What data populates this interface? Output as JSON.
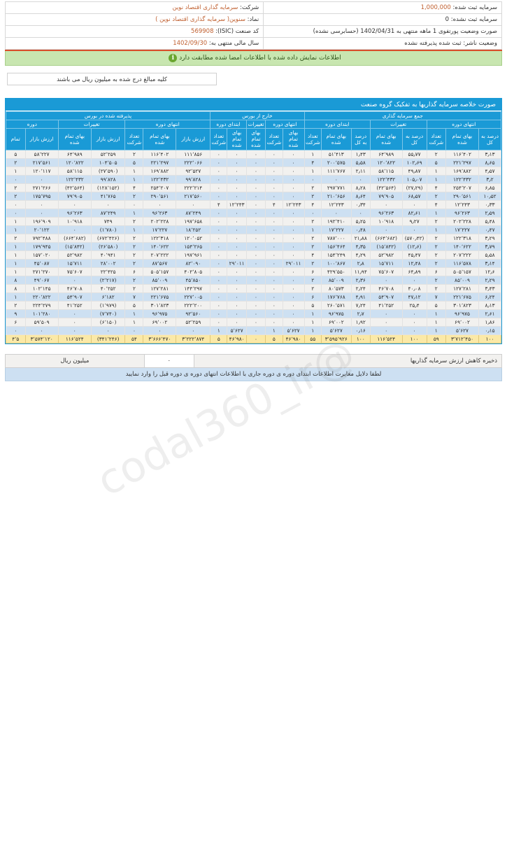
{
  "header": {
    "company_label": "شرکت:",
    "company_value": "سرمایه گذاری اقتصاد نوین",
    "registered_capital_label": "سرمایه ثبت شده:",
    "registered_capital_value": "1,000,000",
    "symbol_label": "نماد:",
    "symbol_value": "سنوین( سرمایه گذاری اقتصاد نوین )",
    "unregistered_capital_label": "سرمایه ثبت نشده:",
    "unregistered_capital_value": "0",
    "isic_label": "کد صنعت (ISIC):",
    "isic_value": "569908",
    "statement_label": "صورت وضعیت پورتفوی  1 ماهه منتهی به 1402/04/31 (حسابرسی نشده)",
    "fiscal_year_label": "سال مالی منتهی به:",
    "fiscal_year_value": "1402/09/30",
    "publisher_status_label": "وضعیت ناشر:",
    "publisher_status_value": "ثبت شده پذیرفته نشده",
    "notice": "اطلاعات نمایش داده شده با اطلاعات امضا شده مطابقت دارد",
    "notice_icon": "info-icon",
    "unit_note": "کلیه مبالغ درج شده به میلیون ریال می باشند"
  },
  "watermark": "@codal360_ir",
  "table": {
    "title": "صورت خلاصه سرمایه گذاریها به تفکیک گروه صنعت",
    "groups": [
      {
        "label": "پذیرفته شده در بورس",
        "span": 11
      },
      {
        "label": "خارج از بورس",
        "span": 8
      },
      {
        "label": "جمع سرمایه گذاری",
        "span": 8
      }
    ],
    "subgroups": [
      {
        "label": "دوره",
        "span": 3
      },
      {
        "label": "تغییرات",
        "span": 3
      },
      {
        "label": "انتهای دوره",
        "span": 3
      },
      {
        "label": "ابتدای دوره",
        "span": 3
      },
      {
        "label": "تغییرات",
        "span": 2
      },
      {
        "label": "انتهای دوره",
        "span": 2
      },
      {
        "label": "ابتدای دوره",
        "span": 3
      },
      {
        "label": "تغییرات",
        "span": 2
      },
      {
        "label": "انتهای دوره",
        "span": 3
      }
    ],
    "columns": [
      "درصد به کل",
      "بهای تمام شده",
      "تعداد شرکت",
      "درصد به کل",
      "بهای تمام شده",
      "درصد به کل",
      "بهای تمام شده",
      "تعداد شرکت",
      "بهای تمام شده",
      "تعداد شرکت",
      "بهای تمام شده",
      "بهای تمام شده",
      "تعداد شرکت",
      "ارزش بازار",
      "بهای تمام شده",
      "تعداد شرکت",
      "ارزش بازار",
      "بهای تمام شده",
      "ارزش بازار",
      "تمام"
    ],
    "rows": [
      {
        "zebra": "odd",
        "cells": [
          "٣٫١٣",
          "١١۶٬۴٠٢",
          "٢",
          "۵۵٫٧٧",
          "۶۴٬٩٨٩",
          "١٫۴٣",
          "۵١٬۴١٣",
          "١",
          "٠",
          "٠",
          "٠",
          "٠",
          "٠",
          "١١١٬٨۵۶",
          "١١۶٬۴٠٢",
          "٢",
          "۵٢٬٢۵٩",
          "۶۴٬٩٨٩",
          "۵٨٬٢٢٧",
          "۵"
        ]
      },
      {
        "zebra": "even",
        "cells": [
          "٨٫۶۵",
          "٢٢١٬٢٩٧",
          "۵",
          "١٠٢٫۶٩",
          "١٢٠٬٨٢٢",
          "۵٫۵٨",
          "٢٠٠٬۵٧۵",
          "۴",
          "٠",
          "٠",
          "٠",
          "٠",
          "٠",
          "٢٢٢٬٠۶۶",
          "٢٢١٬٢٩٧",
          "۵",
          "١٠۴٬۵٠۵",
          "١٢٠٬٨٢٢",
          "٢١٧٬۵۶١",
          "٢"
        ]
      },
      {
        "zebra": "odd",
        "cells": [
          "۴٫۵٧",
          "١۶٩٬٨٨٢",
          "١",
          "۴٩٫٨٧",
          "۵٨٬١١۵",
          "٢٫١١",
          "١١١٬٧۶٧",
          "١",
          "٠",
          "٠",
          "٠",
          "٠",
          "٠",
          "٩٢٬۵٢٧",
          "١۶٩٬٨٨٢",
          "١",
          "(٢٧٬۵٩٠)",
          "۵٨٬١١۵",
          "١٢٠٬١١٧",
          "١"
        ],
        "neg": [
          15
        ]
      },
      {
        "zebra": "even",
        "cells": [
          "٣٫٢",
          "١٢٢٬۴٣٢",
          "١",
          "١٠۵٫٠٧",
          "١٢٢٬۴٣٢",
          "٠",
          "٠",
          "٠",
          "٠",
          "٠",
          "٠",
          "٠",
          "٠",
          "٩٩٬٨٢٨",
          "١٢٢٬۴٣٢",
          "١",
          "٩٩٬٨٢٨",
          "١٢٢٬۴٣٢",
          "٠",
          "٠"
        ]
      },
      {
        "zebra": "odd",
        "cells": [
          "۶٫٨۵",
          "٢۵۴٬٢٠٧",
          "۴",
          "(٢٧٫٢٩)",
          "(۴٢٬۵۶۴)",
          "٨٫٢٨",
          "٢٩٧٬٧٧١",
          "٢",
          "٠",
          "٠",
          "٠",
          "٠",
          "٠",
          "٢٢٢٬٢١۴",
          "٢۵۴٬٢٠٧",
          "۴",
          "(١٢٨٬١۵٢)",
          "(۴٢٬۵۶۴)",
          "٢٧١٬٢۶۶",
          "٢"
        ],
        "neg": [
          3,
          4,
          15,
          16
        ]
      },
      {
        "zebra": "even",
        "cells": [
          "١٠٫۵٢",
          "٢٩٠٬۵۶١",
          "٢",
          "۶٨٫۵٧",
          "٧٩٬٩٠۵",
          "٨٫۶۴",
          "٢١٠٬۶۵۶",
          "٢",
          "٠",
          "٠",
          "٠",
          "٠",
          "٠",
          "٢١٧٬۵۶٠",
          "٢٩٠٬۵۶١",
          "٢",
          "۴١٬٧۶۵",
          "٧٩٬٩٠۵",
          "١٧۵٬٧٩۵",
          "٢"
        ]
      },
      {
        "zebra": "odd",
        "cells": [
          "٠٫٣٣",
          "١٢٬٢۴٣",
          "۴",
          "٠",
          "٠",
          "٠٫٣۴",
          "١٢٬٢۴٣",
          "۴",
          "١٢٬٢۴٣",
          "۴",
          "٠",
          "١٢٬٢۴٣",
          "۴",
          "٠",
          "٠",
          "٠",
          "٠",
          "٠",
          "٠",
          "٠"
        ]
      },
      {
        "zebra": "even",
        "cells": [
          "٢٫۵٩",
          "٩۶٬٢۶٣",
          "١",
          "٨٢٫۶١",
          "٩۶٬٢۶٣",
          "٠",
          "٠",
          "٠",
          "٠",
          "٠",
          "٠",
          "٠",
          "٠",
          "٨٧٬٢۴٩",
          "٩۶٬٢۶٣",
          "١",
          "٨٧٬٢۴٩",
          "٩۶٬٢۶٣",
          "٠",
          "٠"
        ]
      },
      {
        "zebra": "odd",
        "cells": [
          "۵٫۴٨",
          "٢٠٢٬٢٢٨",
          "٢",
          "٩٫٢٧",
          "١٠٬٩١٨",
          "۵٫٢۵",
          "١٩٢٬۴١٠",
          "٢",
          "٠",
          "٠",
          "٠",
          "٠",
          "٠",
          "١٩٧٬۶۵٨",
          "٢٠٢٬٢٢٨",
          "٢",
          "٧۴٩",
          "١٠٬٩١٨",
          "١٩۶٬٩٠٩",
          "١"
        ]
      },
      {
        "zebra": "even",
        "cells": [
          "٠٫۴٧",
          "١٧٬٢٢٧",
          "١",
          "٠",
          "٠",
          "٠٫۴٨",
          "١٧٬٢٢٧",
          "١",
          "٠",
          "٠",
          "٠",
          "٠",
          "٠",
          "١٨٬٢۵٢",
          "١٧٬٢٢٧",
          "١",
          "(١٬٧٨٠)",
          "٠",
          "٢٠٬١٢٢",
          "١"
        ],
        "neg": [
          15
        ]
      },
      {
        "zebra": "odd",
        "cells": [
          "٣٫٢٩",
          "١٢٢٬٣١٨",
          "٢",
          "(۵٧٠٫۴٢)",
          "(۶۶۴٬۶٨٢)",
          "٢١٫٨٨",
          "٧٨٧٬٠٠٠",
          "٢",
          "٠",
          "٠",
          "٠",
          "٠",
          "٠",
          "١٢٠٬٠۵٢",
          "١٢٢٬٣١٨",
          "٢",
          "(۶٧٢٬۴٢۶)",
          "(۶۶۴٬۶٨٢)",
          "٧٩٢٬۴٨٨",
          "٢"
        ],
        "neg": [
          3,
          4,
          15,
          16
        ]
      },
      {
        "zebra": "even",
        "cells": [
          "٣٫٧٩",
          "١۴٠٬۶٢٢",
          "٢",
          "(١٢٫۶)",
          "(١۵٬٨۴٢)",
          "۴٫٣۵",
          "١۵۶٬۴۶۴",
          "٢",
          "٠",
          "٠",
          "٠",
          "٠",
          "٠",
          "١۵۴٬٢۶۵",
          "١۴٠٬۶٢٢",
          "٢",
          "(٢۶٬۵٨٠)",
          "(١۵٬٨۴٢)",
          "١٧٩٬٩۴۵",
          "١"
        ],
        "neg": [
          3,
          4,
          15,
          16
        ]
      },
      {
        "zebra": "odd",
        "cells": [
          "۵٫۵٨",
          "٢٠٧٬٢٢٢",
          "٢",
          "۴۵٫۴٧",
          "۵٢٬٩٨٢",
          "۴٫٢٩",
          "١۵۴٬٢۴٩",
          "۴",
          "٠",
          "٠",
          "٠",
          "٠",
          "٠",
          "١٩٧٬٩۶١",
          "٢٠٧٬٢٢٢",
          "٢",
          "۴٠٬٩۴١",
          "۵٢٬٩٨٢",
          "١۵٧٬٠٢٠",
          "١"
        ]
      },
      {
        "zebra": "even",
        "cells": [
          "٣٫١۴",
          "١١۶٬۵٧٨",
          "٢",
          "١٢٫۴٨",
          "١۵٬٧١١",
          "٢٫٨",
          "١٠٠٬٨۶٧",
          "٢",
          "٢٩٬٠١١",
          "٠",
          "٠",
          "٢٩٬٠١١",
          "٠",
          "٨٢٬٠٩٠",
          "٨٧٬۵۶٧",
          "٢",
          "٢٨٬٠٠٢",
          "١۵٬٧١١",
          "۴۵٬٠٨٧",
          "١"
        ]
      },
      {
        "zebra": "odd",
        "cells": [
          "١٢٫۶",
          "۵٠۵٬١۵٧",
          "۶",
          "۶۴٫٨٩",
          "٧۵٬۶٠٧",
          "١١٫٩۴",
          "۴٢٩٬۵۵٠",
          "۶",
          "٠",
          "٠",
          "٠",
          "٠",
          "٠",
          "۴٠٢٬٨٠۵",
          "۵٠۵٬١۵٧",
          "۶",
          "٢٢٬۴٢۵",
          "٧۵٬۶٠٧",
          "٢٧١٬٢٧٠",
          "١"
        ]
      },
      {
        "zebra": "even",
        "cells": [
          "٢٫٢٩",
          "٨۵٬٠٠٩",
          "٢",
          "٠",
          "٠",
          "٢٫٣۶",
          "٨۵٬٠٠٩",
          "٢",
          "٠",
          "٠",
          "٠",
          "٠",
          "٠",
          "۴۵٬٨۵٠",
          "٨۵٬٠٠٩",
          "٢",
          "(٢٬٢١٧)",
          "٠",
          "۴٩٬٠۶٧",
          "٨"
        ],
        "neg": [
          15
        ]
      },
      {
        "zebra": "odd",
        "cells": [
          "٣٫۴٣",
          "١٢٧٬٢٨١",
          "٢",
          "۴٠٫٠٨",
          "۴۶٬٧٠٨",
          "٢٫٢۴",
          "٨٠٬۵٧٣",
          "٢",
          "٠",
          "٠",
          "٠",
          "٠",
          "٠",
          "١۴۴٬٢٩٧",
          "١٢٧٬٢٨١",
          "٢",
          "۴٠٬٢۵٢",
          "۴۶٬٧٠٨",
          "١٠٢٬١۴۵",
          "٨"
        ]
      },
      {
        "zebra": "even",
        "cells": [
          "۶٫٢۴",
          "٢٢١٬۶٧۵",
          "٧",
          "۴٧٫١٢",
          "۵۴٬٩٠٧",
          "۴٫٩١",
          "١٧۶٬٧۶٨",
          "۶",
          "٠",
          "٠",
          "٠",
          "٠",
          "٠",
          "٢٢٧٬٠٠۵",
          "٢٢١٬۶٧۵",
          "٧",
          "۶٬١٨٢",
          "۵۴٬٩٠٧",
          "٢٢٠٬٨٢٢",
          "١"
        ]
      },
      {
        "zebra": "odd",
        "cells": [
          "٨٫١٣",
          "٣٠١٬٨٢٣",
          "۵",
          "٢۵٫۴",
          "۴١٬٢۵٢",
          "٧٫٢۴",
          "٢۶٠٬۵٧١",
          "۵",
          "٠",
          "٠",
          "٠",
          "٠",
          "٠",
          "٢٢٢٬٢٠٠",
          "٣٠١٬٨٢٣",
          "۵",
          "(١٬٩٧٩)",
          "۴١٬٢۵٢",
          "٢٢۴٬٢٧٩",
          "٢"
        ],
        "neg": [
          15
        ]
      },
      {
        "zebra": "even",
        "cells": [
          "٢٫۶١",
          "٩۶٬٩٧۵",
          "١",
          "٠",
          "٠",
          "٢٫٧",
          "٩۶٬٩٧۵",
          "١",
          "٠",
          "٠",
          "٠",
          "٠",
          "٠",
          "٩٢٬۵۶٠",
          "٩۶٬٩٧۵",
          "١",
          "(٧٬٧۴٠)",
          "٠",
          "١٠١٬٢٨٠",
          "٩"
        ],
        "neg": [
          15
        ]
      },
      {
        "zebra": "odd",
        "cells": [
          "١٫٨۶",
          "۶٩٬٠٠٢",
          "١",
          "٠",
          "٠",
          "١٫٩٢",
          "۶٩٬٠٠٢",
          "١",
          "٠",
          "٠",
          "٠",
          "٠",
          "٠",
          "۵٢٬٢۵٩",
          "۶٩٬٠٠٢",
          "١",
          "(۶٬١۵٠)",
          "٠",
          "۵٩٬۵٠٩",
          "۶"
        ],
        "neg": [
          15
        ]
      },
      {
        "zebra": "even",
        "cells": [
          "٠٫١۵",
          "۵٬۶٢٧",
          "١",
          "٠",
          "٠",
          "٠٫١۶",
          "۵٬۶٢٧",
          "١",
          "۵٬۶٢٧",
          "١",
          "٠",
          "۵٬۶٢٧",
          "١",
          "٠",
          "٠",
          "٠",
          "٠",
          "٠",
          "٠",
          "٠"
        ]
      }
    ],
    "total_row": {
      "cells": [
        "١٠٠",
        "٣٬٧١٢٬۴۵٠",
        "۵٩",
        "١٠٠",
        "١١۶٬۵٢۴",
        "١٠٠",
        "٣٬۵٩۵٬٩٢۶",
        "۵۵",
        "۴۶٬٩٨٠",
        "۵",
        "٠",
        "۴۶٬٩٨٠",
        "۵",
        "٣٬٢٢٢٬٨٧۴",
        "٣٬۶۶۶٬۴٧٠",
        "۵۴",
        "(٣۴١٬٢۴۶)",
        "١١۶٬۵٢۴",
        "٣٬۵٧۴٬١٢٠",
        "۴٬۵"
      ],
      "neg": [
        16
      ]
    }
  },
  "footer": {
    "reserve_label": "ذخیره کاهش ارزش سرمایه گذاریها",
    "reserve_value": "٠",
    "reserve_unit": "میلیون ریال",
    "note": "لطفا دلایل مغایرت اطلاعات ابتدای دوره ی دوره جاری با اطلاعات انتهای دوره ی دوره قبل را وارد نمایید"
  }
}
